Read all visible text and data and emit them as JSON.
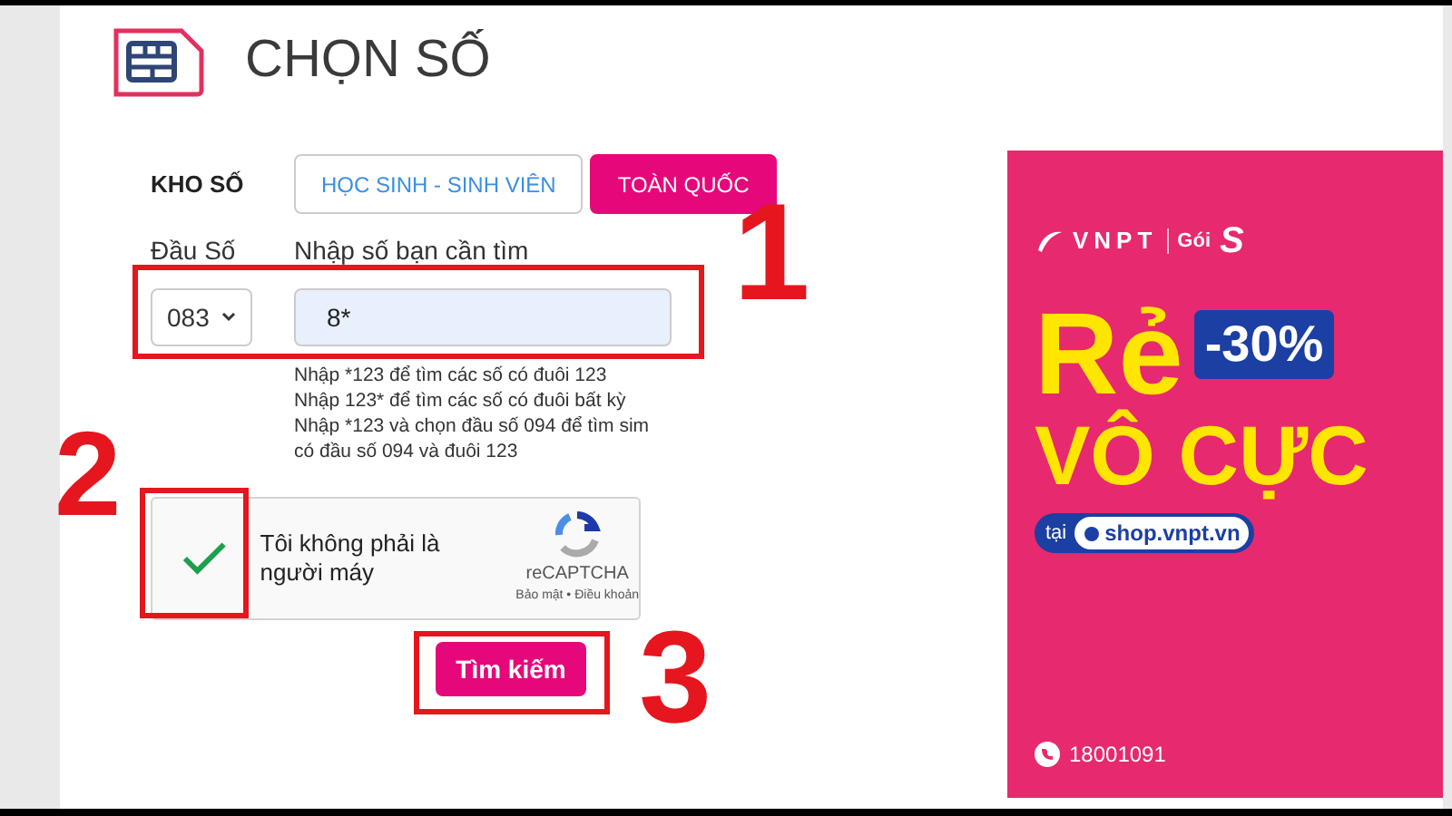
{
  "header": {
    "title": "CHỌN SỐ"
  },
  "stock": {
    "label": "KHO SỐ",
    "tabs": [
      {
        "label": "HỌC SINH - SINH VIÊN",
        "selected": false
      },
      {
        "label": "TOÀN QUỐC",
        "selected": true
      }
    ]
  },
  "prefix": {
    "label": "Đầu Số",
    "value": "083"
  },
  "number": {
    "label": "Nhập số bạn cần tìm",
    "value": "8*"
  },
  "hints": [
    "Nhập *123 để tìm các số có đuôi 123",
    "Nhập 123* để tìm các số có đuôi bất kỳ",
    "Nhập *123 và chọn đầu số 094 để tìm sim",
    "có đầu số 094 và đuôi 123"
  ],
  "captcha": {
    "label": "Tôi không phải là người máy",
    "checked": true,
    "brand": "reCAPTCHA",
    "links": "Bảo mật • Điều khoản"
  },
  "search_button": "Tìm kiếm",
  "ad": {
    "brand": "VNPT",
    "package_prefix": "Gói",
    "package": "S",
    "headline_1": "Rẻ",
    "discount": "-30%",
    "headline_2": "VÔ CỰC",
    "at": "tại",
    "site": "shop.vnpt.vn",
    "phone": "18001091"
  },
  "annotations": [
    {
      "label": "1"
    },
    {
      "label": "2"
    },
    {
      "label": "3"
    }
  ]
}
